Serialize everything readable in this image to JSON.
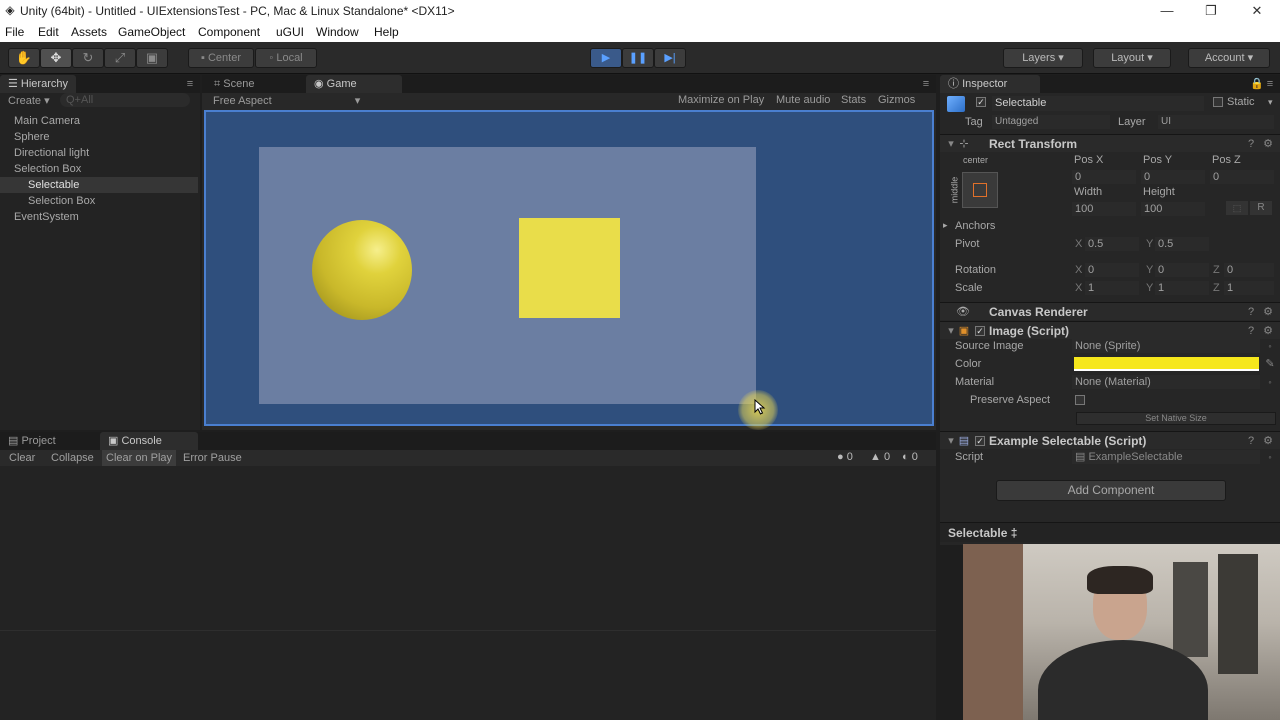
{
  "window": {
    "title": "Unity (64bit) - Untitled - UIExtensionsTest - PC, Mac & Linux Standalone* <DX11>"
  },
  "menu": [
    "File",
    "Edit",
    "Assets",
    "GameObject",
    "Component",
    "uGUI",
    "Window",
    "Help"
  ],
  "toolbar": {
    "pivot_label": "Center",
    "space_label": "Local",
    "layers_label": "Layers",
    "layout_label": "Layout",
    "account_label": "Account"
  },
  "hierarchy": {
    "tab": "Hierarchy",
    "create_label": "Create",
    "search_placeholder": "Q+All",
    "items": [
      "Main Camera",
      "Sphere",
      "Directional light",
      "Selection Box",
      "Selectable",
      "Selection Box",
      "EventSystem"
    ]
  },
  "game_view": {
    "tabs": [
      "Scene",
      "Game"
    ],
    "aspect": "Free Aspect",
    "options": [
      "Maximize on Play",
      "Mute audio",
      "Stats",
      "Gizmos"
    ],
    "colors": {
      "background": "#2f4f7d",
      "canvas": "#6b7ea2",
      "yellow": "#e9dd4a"
    }
  },
  "bottom": {
    "tabs": [
      "Project",
      "Console"
    ],
    "buttons": [
      "Clear",
      "Collapse",
      "Clear on Play",
      "Error Pause"
    ],
    "counts": [
      "0",
      "0",
      "0"
    ]
  },
  "inspector": {
    "tab": "Inspector",
    "object_name": "Selectable",
    "static_label": "Static",
    "tag_label": "Tag",
    "tag_value": "Untagged",
    "layer_label": "Layer",
    "layer_value": "UI",
    "rect_transform": {
      "title": "Rect Transform",
      "anchor_h": "center",
      "anchor_v": "middle",
      "pos_x_label": "Pos X",
      "pos_y_label": "Pos Y",
      "pos_z_label": "Pos Z",
      "pos_x": "0",
      "pos_y": "0",
      "pos_z": "0",
      "width_label": "Width",
      "height_label": "Height",
      "width": "100",
      "height": "100",
      "anchors_label": "Anchors",
      "pivot_label": "Pivot",
      "pivot_x": "0.5",
      "pivot_y": "0.5",
      "rotation_label": "Rotation",
      "rot_x": "0",
      "rot_y": "0",
      "rot_z": "0",
      "scale_label": "Scale",
      "scale_x": "1",
      "scale_y": "1",
      "scale_z": "1",
      "x": "X",
      "y": "Y",
      "z": "Z",
      "r_btn": "R"
    },
    "canvas_renderer": "Canvas Renderer",
    "image": {
      "title": "Image (Script)",
      "source_label": "Source Image",
      "source_value": "None (Sprite)",
      "color_label": "Color",
      "color_value": "#f6e71c",
      "material_label": "Material",
      "material_value": "None (Material)",
      "preserve_label": "Preserve Aspect",
      "native_size": "Set Native Size"
    },
    "example": {
      "title": "Example Selectable (Script)",
      "script_label": "Script",
      "script_value": "ExampleSelectable"
    },
    "add_component": "Add Component",
    "footer": "Selectable ‡"
  }
}
